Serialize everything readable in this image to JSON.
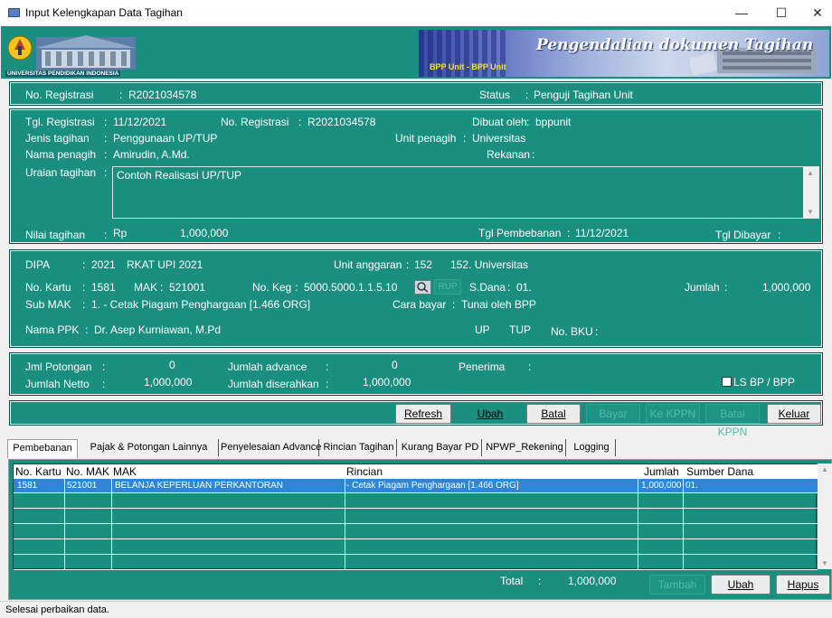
{
  "window": {
    "title": "Input Kelengkapan Data Tagihan",
    "minimize": "—",
    "maximize": "☐",
    "close": "✕"
  },
  "banner": {
    "logo_caption": "UNIVERSITAS PENDIDIKAN INDONESIA",
    "bpp_unit": "BPP Unit - BPP Unit",
    "heading": "Pengendalian dokumen Tagihan"
  },
  "reg_bar": {
    "no_reg_label": "No. Registrasi",
    "no_reg_value": "R2021034578",
    "status_label": "Status",
    "status_value": "Penguji Tagihan Unit"
  },
  "detail": {
    "tgl_reg_label": "Tgl. Registrasi",
    "tgl_reg_value": "11/12/2021",
    "no_reg_label": "No. Registrasi",
    "no_reg_value": "R2021034578",
    "dibuat_label": "Dibuat oleh",
    "dibuat_value": "bppunit",
    "jenis_label": "Jenis tagihan",
    "jenis_value": "Penggunaan UP/TUP",
    "unit_penagih_label": "Unit penagih",
    "unit_penagih_value": "Universitas",
    "nama_penagih_label": "Nama penagih",
    "nama_penagih_value": "Amirudin, A.Md.",
    "rekanan_label": "Rekanan",
    "rekanan_value": "",
    "uraian_label": "Uraian tagihan",
    "uraian_value": "Contoh Realisasi UP/TUP",
    "nilai_label": "Nilai tagihan",
    "nilai_currency": "Rp",
    "nilai_value": "1,000,000",
    "tgl_pembebanan_label": "Tgl Pembebanan",
    "tgl_pembebanan_value": "11/12/2021",
    "tgl_dibayar_label": "Tgl Dibayar",
    "tgl_dibayar_value": ""
  },
  "dipa": {
    "dipa_label": "DIPA",
    "dipa_year": "2021",
    "dipa_value": "RKAT UPI 2021",
    "unit_anggaran_label": "Unit anggaran",
    "unit_anggaran_code": "152",
    "unit_anggaran_value": "152. Universitas",
    "no_kartu_label": "No. Kartu",
    "no_kartu_value": "1581",
    "mak_label": "MAK",
    "mak_value": "521001",
    "no_keg_label": "No. Keg",
    "no_keg_value": "5000.5000.1.1.5.10",
    "rup_label": "RUP",
    "sdana_label": "S.Dana",
    "sdana_value": "01.",
    "jumlah_label": "Jumlah",
    "jumlah_value": "1,000,000",
    "sub_mak_label": "Sub MAK",
    "sub_mak_value": "1. - Cetak Piagam Penghargaan [1.466 ORG]",
    "cara_bayar_label": "Cara bayar",
    "cara_bayar_value": "Tunai oleh BPP",
    "nama_ppk_label": "Nama PPK",
    "nama_ppk_value": "Dr. Asep Kurniawan, M.Pd",
    "up_label": "UP",
    "tup_label": "TUP",
    "no_bku_label": "No. BKU",
    "no_bku_value": ""
  },
  "potongan": {
    "jml_potongan_label": "Jml Potongan",
    "jml_potongan_value": "0",
    "jumlah_advance_label": "Jumlah advance",
    "jumlah_advance_value": "0",
    "penerima_label": "Penerima",
    "penerima_value": "",
    "jumlah_netto_label": "Jumlah Netto",
    "jumlah_netto_value": "1,000,000",
    "jumlah_diserahkan_label": "Jumlah diserahkan",
    "jumlah_diserahkan_value": "1,000,000",
    "ls_bp_label": "LS BP / BPP"
  },
  "buttons": {
    "refresh": "Refresh",
    "ubah": "Ubah",
    "batal": "Batal",
    "bayar": "Bayar",
    "ke_kppn": "Ke KPPN",
    "batal_kppn": "Batal KPPN",
    "keluar": "Keluar"
  },
  "tabs": [
    "Pembebanan",
    "Pajak & Potongan Lainnya",
    "Penyelesaian Advance",
    "Rincian Tagihan",
    "Kurang Bayar PD",
    "NPWP_Rekening",
    "Logging"
  ],
  "grid": {
    "columns": [
      "No. Kartu",
      "No. MAK",
      "MAK",
      "Rincian",
      "Jumlah",
      "Sumber Dana"
    ],
    "rows": [
      [
        "1581",
        "521001",
        "BELANJA KEPERLUAN PERKANTORAN",
        "- Cetak Piagam Penghargaan [1.466 ORG]",
        "1,000,000",
        "01."
      ]
    ]
  },
  "footer": {
    "total_label": "Total",
    "total_value": "1,000,000",
    "tambah": "Tambah",
    "ubah": "Ubah",
    "hapus": "Hapus"
  },
  "status_bar": "Selesai perbaikan data.",
  "colors": {
    "panel": "#1a8f80",
    "selected_row": "#2e86d9",
    "accent_yellow": "#f6e61e"
  }
}
